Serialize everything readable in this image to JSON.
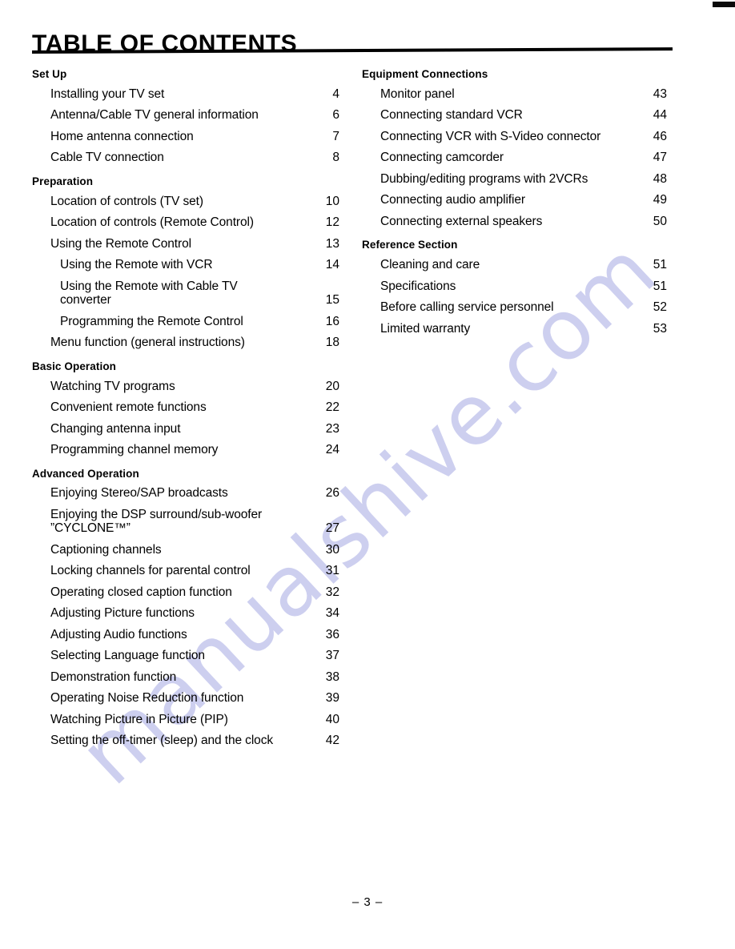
{
  "document": {
    "title": "TABLE OF CONTENTS",
    "footer": "– 3 –",
    "watermark": "manualshive.com",
    "accent_color": "#000000",
    "watermark_color": "#c9cbee"
  },
  "columns": {
    "left": [
      {
        "heading": "Set Up",
        "entries": [
          {
            "title": "Installing your TV set",
            "page": "4",
            "level": 1
          },
          {
            "title": "Antenna/Cable TV general information",
            "page": "6",
            "level": 1
          },
          {
            "title": "Home antenna connection",
            "page": "7",
            "level": 1
          },
          {
            "title": "Cable TV connection",
            "page": "8",
            "level": 1
          }
        ]
      },
      {
        "heading": "Preparation",
        "entries": [
          {
            "title": "Location of controls (TV set)",
            "page": "10",
            "level": 1
          },
          {
            "title": "Location of controls (Remote Control)",
            "page": "12",
            "level": 1
          },
          {
            "title": "Using the Remote Control",
            "page": "13",
            "level": 1
          },
          {
            "title": "Using the Remote with VCR",
            "page": "14",
            "level": 2
          },
          {
            "title": "Using the Remote with Cable TV",
            "title2": "converter",
            "page": "15",
            "level": 2
          },
          {
            "title": "Programming the Remote Control",
            "page": "16",
            "level": 2
          },
          {
            "title": "Menu function (general instructions)",
            "page": "18",
            "level": 1
          }
        ]
      },
      {
        "heading": "Basic Operation",
        "entries": [
          {
            "title": "Watching TV programs",
            "page": "20",
            "level": 1
          },
          {
            "title": "Convenient remote functions",
            "page": "22",
            "level": 1
          },
          {
            "title": "Changing antenna input",
            "page": "23",
            "level": 1
          },
          {
            "title": "Programming channel memory",
            "page": "24",
            "level": 1
          }
        ]
      },
      {
        "heading": "Advanced Operation",
        "entries": [
          {
            "title": "Enjoying Stereo/SAP broadcasts",
            "page": "26",
            "level": 1
          },
          {
            "title": "Enjoying the DSP surround/sub-woofer",
            "title2": "”CYCLONE™”",
            "page": "27",
            "level": 1
          },
          {
            "title": "Captioning channels",
            "page": "30",
            "level": 1
          },
          {
            "title": "Locking channels for parental control",
            "page": "31",
            "level": 1
          },
          {
            "title": "Operating closed caption function",
            "page": "32",
            "level": 1
          },
          {
            "title": "Adjusting Picture functions",
            "page": "34",
            "level": 1
          },
          {
            "title": "Adjusting Audio functions",
            "page": "36",
            "level": 1
          },
          {
            "title": "Selecting Language function",
            "page": "37",
            "level": 1
          },
          {
            "title": "Demonstration function",
            "page": "38",
            "level": 1
          },
          {
            "title": "Operating Noise Reduction function",
            "page": "39",
            "level": 1
          },
          {
            "title": "Watching Picture in Picture (PIP)",
            "page": "40",
            "level": 1
          },
          {
            "title": "Setting the off-timer (sleep) and the clock",
            "page": "42",
            "level": 1
          }
        ]
      }
    ],
    "right": [
      {
        "heading": "Equipment Connections",
        "entries": [
          {
            "title": "Monitor panel",
            "page": "43",
            "level": 1
          },
          {
            "title": "Connecting standard VCR",
            "page": "44",
            "level": 1
          },
          {
            "title": "Connecting VCR with S-Video connector",
            "page": "46",
            "level": 1
          },
          {
            "title": "Connecting camcorder",
            "page": "47",
            "level": 1
          },
          {
            "title": "Dubbing/editing programs with 2VCRs",
            "page": "48",
            "level": 1
          },
          {
            "title": "Connecting audio amplifier",
            "page": "49",
            "level": 1
          },
          {
            "title": "Connecting external speakers",
            "page": "50",
            "level": 1
          }
        ]
      },
      {
        "heading": "Reference Section",
        "entries": [
          {
            "title": "Cleaning and care",
            "page": "51",
            "level": 1
          },
          {
            "title": "Specifications",
            "page": "51",
            "level": 1
          },
          {
            "title": "Before calling service personnel",
            "page": "52",
            "level": 1
          },
          {
            "title": "Limited warranty",
            "page": "53",
            "level": 1
          }
        ]
      }
    ]
  }
}
